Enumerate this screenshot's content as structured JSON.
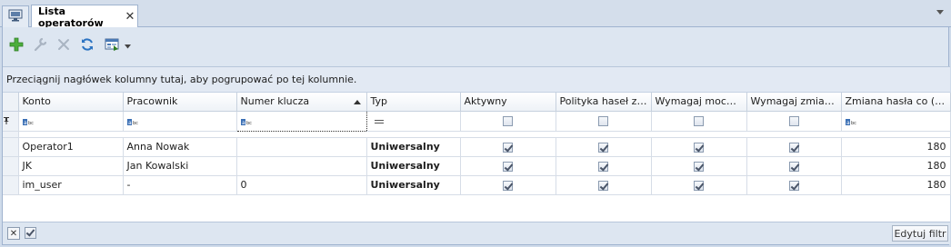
{
  "tab": {
    "title": "Lista operatorów",
    "close_glyph": "✕"
  },
  "toolbar": {
    "buttons": [
      {
        "icon": "plus-icon",
        "label": "Dodaj"
      },
      {
        "icon": "wrench-icon",
        "label": "Edytuj"
      },
      {
        "icon": "delete-icon",
        "label": "Usuń"
      },
      {
        "icon": "refresh-icon",
        "label": "Odśwież"
      },
      {
        "icon": "export-icon",
        "label": "Eksport"
      }
    ]
  },
  "grid": {
    "group_panel_text": "Przeciągnij nagłówek kolumny tutaj, aby pogrupować po tej kolumnie.",
    "columns": [
      "Konto",
      "Pracownik",
      "Numer klucza",
      "Typ",
      "Aktywny",
      "Polityka haseł z k...",
      "Wymagaj mocne...",
      "Wymagaj zmian ...",
      "Zmiana hasła co (dni)"
    ],
    "sorted_column": "Numer klucza",
    "rows": [
      {
        "konto": "Operator1",
        "pracownik": "Anna Nowak",
        "numer_klucza": "",
        "typ": "Uniwersalny",
        "aktywny": true,
        "polityka": true,
        "wymagaj_mocne": true,
        "wymagaj_zmian": true,
        "zmiana_hasla": "180"
      },
      {
        "konto": "JK",
        "pracownik": "Jan Kowalski",
        "numer_klucza": "",
        "typ": "Uniwersalny",
        "aktywny": true,
        "polityka": true,
        "wymagaj_mocne": true,
        "wymagaj_zmian": true,
        "zmiana_hasla": "180"
      },
      {
        "konto": "im_user",
        "pracownik": "-",
        "numer_klucza": "0",
        "typ": "Uniwersalny",
        "aktywny": true,
        "polityka": true,
        "wymagaj_mocne": true,
        "wymagaj_zmian": true,
        "zmiana_hasla": "180"
      }
    ]
  },
  "footer": {
    "close_glyph": "✕",
    "edit_filter_label": "Edytuj filtr"
  }
}
